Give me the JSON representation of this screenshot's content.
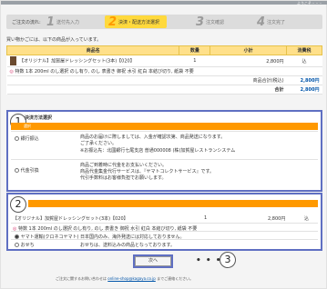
{
  "top_right": "ようこそ・・・",
  "steps": {
    "lead": "ご注文の流れ:",
    "items": [
      {
        "num": "1",
        "label": "送付先入力"
      },
      {
        "num": "2",
        "label": "決済・配送方法選択"
      },
      {
        "num": "3",
        "label": "注文確認"
      },
      {
        "num": "4",
        "label": "注文完了"
      }
    ]
  },
  "intro": "買い物かごには、以下の商品が入っています。",
  "cart": {
    "headers": [
      "商品名",
      "数量",
      "小計",
      "消費税"
    ],
    "product_name": "【オリジナル】加賀屋ドレッシングセット(3本)【020】",
    "quantity": "1",
    "subtotal": "2,800円",
    "tax": "込",
    "option": "特数 1本 200ml のし選択 のし有り, のし 表書き 御祝 水引 紅白 本結び切り, 紙袋 不要",
    "total_label": "商品合計(税込)",
    "total_value": "2,800円",
    "grand_label": "合計",
    "grand_value": "2,800円"
  },
  "section1": {
    "circle": "1",
    "title": "決済方法選択",
    "bar": "選択",
    "options": [
      {
        "label": "銀行振込",
        "desc1": "商品のお届けに際しましては、入金が確認次第、商品発送になります。",
        "desc2": "ご了承ください。",
        "desc3": "※お振込先：北國銀行七尾支店 普通000008 (株)加賀屋レストランシステム"
      },
      {
        "label": "代金引換",
        "desc1": "商品ご到着時に代金をお支払いください。",
        "desc2": "商品代金集金代行サービスは、『ヤマトコレクトサービス』です。",
        "desc3": "代引手数料はお客様負担でお願いします。"
      }
    ]
  },
  "section2": {
    "circle": "2",
    "product_name": "【オリジナル】加賀屋ドレッシングセット(3本)【020】",
    "quantity": "1",
    "subtotal": "2,800円",
    "tax": "込",
    "option": "特数 1本 200ml のし選択 のし有り, のし 表書き 御祝 水引 紅白 本結び切り, 紙袋 不要",
    "ship1": "ヤマト運輸(クロネコヤマト)",
    "ship1_desc": "日本国内のみ、海外発送には対応しておりません。",
    "ship2": "おせち",
    "ship2_desc": "おせちは、送料込みの商品となっております。"
  },
  "next_button": "次へ",
  "circle3": "3",
  "dots": "• • •",
  "footer_text": "ご注文に関するお問い合わせは",
  "footer_link": "online-shop@kagaya.co.jp",
  "footer_tail": "までご連絡ください。"
}
